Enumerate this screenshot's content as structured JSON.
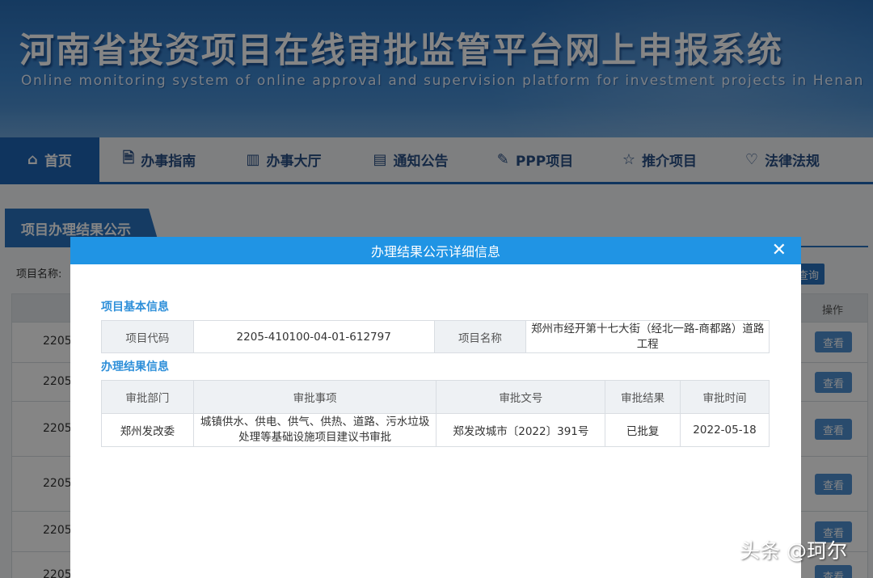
{
  "header": {
    "title": "河南省投资项目在线审批监管平台网上申报系统",
    "subtitle": "Online monitoring system of online approval and supervision platform for investment projects in Henan"
  },
  "nav": {
    "items": [
      {
        "label": "首页",
        "icon": "home-icon"
      },
      {
        "label": "办事指南",
        "icon": "document-icon"
      },
      {
        "label": "办事大厅",
        "icon": "building-icon"
      },
      {
        "label": "通知公告",
        "icon": "notice-icon"
      },
      {
        "label": "PPP项目",
        "icon": "edit-icon"
      },
      {
        "label": "推介项目",
        "icon": "star-icon"
      },
      {
        "label": "法律法规",
        "icon": "handshake-icon"
      }
    ]
  },
  "background": {
    "section_title": "项目办理结果公示",
    "search_label": "项目名称:",
    "query_button": "查询",
    "column_operation": "操作",
    "row_code_prefix": "2205",
    "view_button": "查看"
  },
  "modal": {
    "title": "办理结果公示详细信息",
    "basic_info": {
      "heading": "项目基本信息",
      "code_label": "项目代码",
      "code_value": "2205-410100-04-01-612797",
      "name_label": "项目名称",
      "name_value": "郑州市经开第十七大街（经北一路-商都路）道路工程"
    },
    "result_info": {
      "heading": "办理结果信息",
      "columns": [
        "审批部门",
        "审批事项",
        "审批文号",
        "审批结果",
        "审批时间"
      ],
      "rows": [
        {
          "department": "郑州发改委",
          "item": "城镇供水、供电、供气、供热、道路、污水垃圾处理等基础设施项目建议书审批",
          "doc_no": "郑发改城市〔2022〕391号",
          "result": "已批复",
          "date": "2022-05-18"
        }
      ]
    }
  },
  "watermark": {
    "main": "头条 @珂尔",
    "small": "珂尔"
  }
}
